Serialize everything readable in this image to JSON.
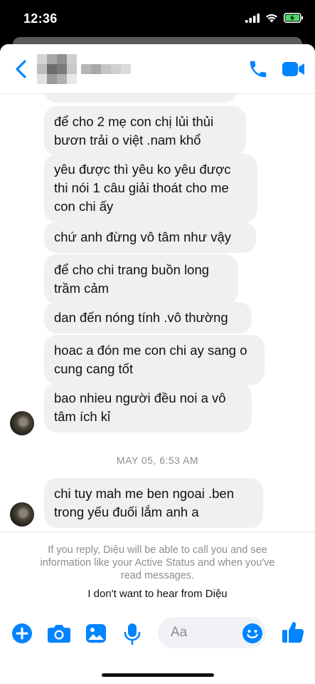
{
  "status_bar": {
    "time": "12:36"
  },
  "header": {
    "blur_colors": [
      "#bdbdbd",
      "#8a8a8a",
      "#6b6b6b",
      "#9a9a9a",
      "#c4c4c4",
      "#a8a8a8",
      "#b6b6b6",
      "#d8d8d8",
      "#cfcfcf",
      "#e0e0e0",
      "#d0d0d0"
    ],
    "accent_color": "#0084ff"
  },
  "messages": [
    {
      "text": "để cho 2 mẹ con chị lủi thủi bươn trải o việt .nam khổ"
    },
    {
      "text": "yêu được thì yêu ko yêu được thi nói 1 câu giải thoát cho me con chi ấy"
    },
    {
      "text": "chứ anh đừng vô tâm như vậy"
    },
    {
      "text": "để cho chi trang buồn long trầm cảm"
    },
    {
      "text": "dan đến nóng tính .vô thường"
    },
    {
      "text": "hoac a đón me con chi ay sang o cung cang tốt"
    },
    {
      "text": "bao nhieu người đều noi a vô tâm ích kỉ"
    },
    {
      "text": "chi tuy mah me ben ngoai .ben trong yếu đuối lắm anh a"
    }
  ],
  "timestamp": "MAY 05, 6:53 AM",
  "reply_notice": {
    "text": "If you reply, Diệu will be able to call you and see information like your Active Status and when you've read messages.",
    "block_link": "I don't want to hear from Diệu"
  },
  "composer": {
    "placeholder": "Aa"
  }
}
